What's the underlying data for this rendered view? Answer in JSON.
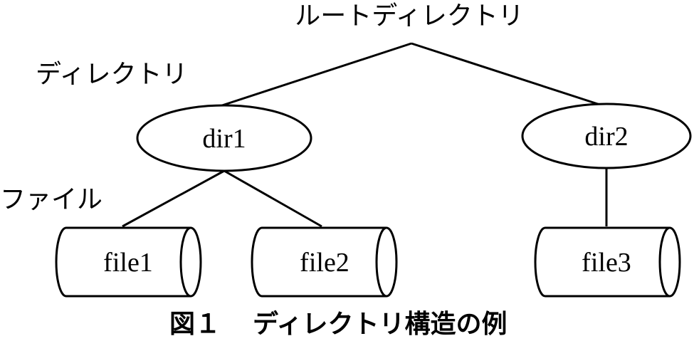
{
  "labels": {
    "root": "ルートディレクトリ",
    "directory": "ディレクトリ",
    "file": "ファイル"
  },
  "nodes": {
    "dir1": "dir1",
    "dir2": "dir2",
    "file1": "file1",
    "file2": "file2",
    "file3": "file3"
  },
  "caption": {
    "figure_number": "図１",
    "title": "ディレクトリ構造の例"
  }
}
